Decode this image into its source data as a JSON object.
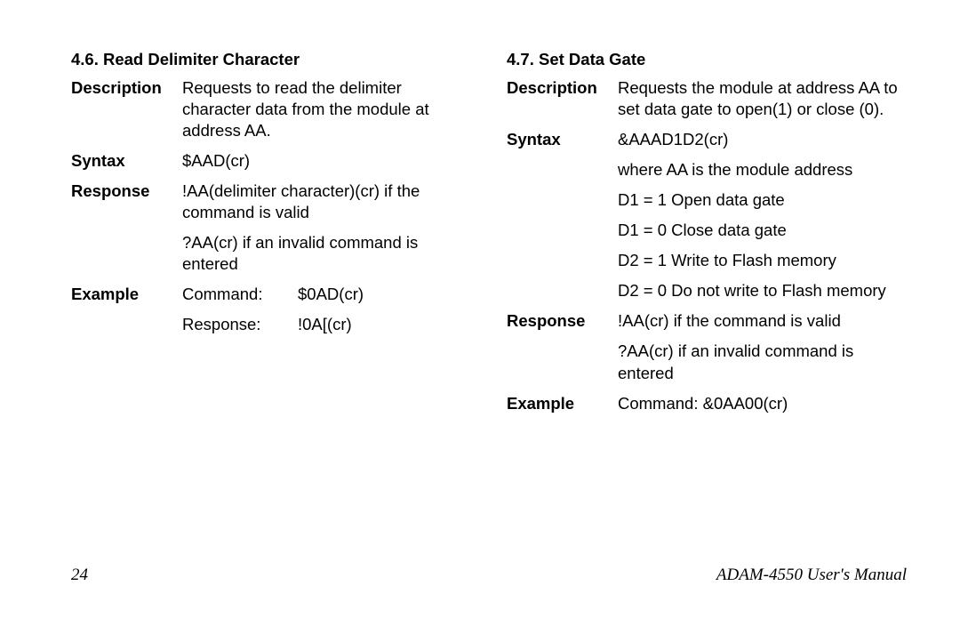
{
  "left": {
    "title": "4.6. Read Delimiter Character",
    "description_label": "Description",
    "description": "Requests to read the delimiter character data from the module at address AA.",
    "syntax_label": "Syntax",
    "syntax": "$AAD(cr)",
    "response_label": "Response",
    "response1": "!AA(delimiter character)(cr) if the command is valid",
    "response2": "?AA(cr)   if an invalid command is entered",
    "example_label": "Example",
    "example_cmd_label": "Command:",
    "example_cmd_value": "$0AD(cr)",
    "example_resp_label": "Response:",
    "example_resp_value": "!0A[(cr)"
  },
  "right": {
    "title": "4.7. Set Data Gate",
    "description_label": "Description",
    "description": "Requests the module at address AA to set data gate to open(1) or close (0).",
    "syntax_label": "Syntax",
    "syntax": "&AAAD1D2(cr)",
    "syntax_d1": "where AA is the module address",
    "syntax_d2": "D1 = 1 Open data gate",
    "syntax_d3": "D1 = 0 Close data gate",
    "syntax_d4": "D2 = 1 Write to Flash memory",
    "syntax_d5": "D2 = 0 Do not write to Flash memory",
    "response_label": "Response",
    "response1": "!AA(cr) if the command is valid",
    "response2": "?AA(cr) if an invalid command is entered",
    "example_label": "Example",
    "example": "Command: &0AA00(cr)"
  },
  "footer": {
    "page": "24",
    "manual": "ADAM-4550 User's Manual"
  }
}
